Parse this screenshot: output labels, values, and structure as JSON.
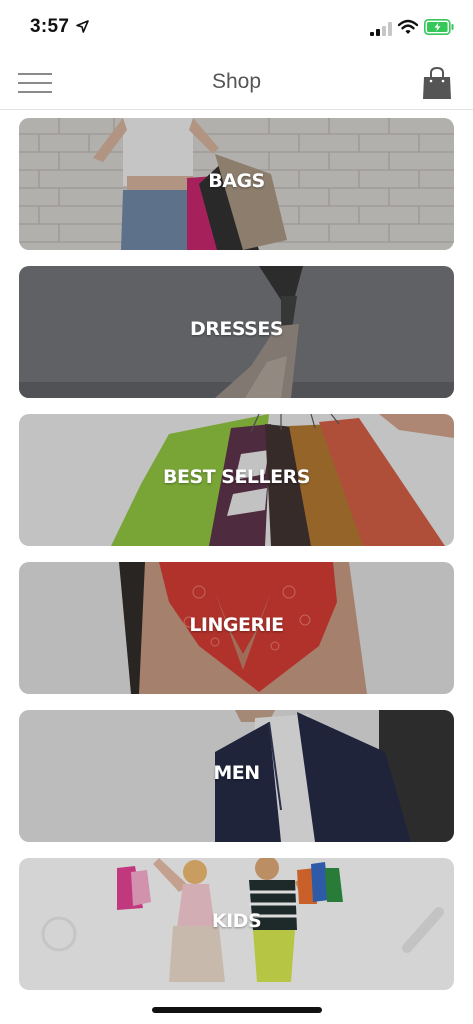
{
  "status_bar": {
    "time": "3:57"
  },
  "nav": {
    "title": "Shop"
  },
  "categories": [
    {
      "label": "BAGS"
    },
    {
      "label": "DRESSES"
    },
    {
      "label": "BEST SELLERS"
    },
    {
      "label": "LINGERIE"
    },
    {
      "label": "MEN"
    },
    {
      "label": "KIDS"
    }
  ],
  "colors": {
    "battery_fill": "#36c759",
    "nav_title": "#555555",
    "label_text": "#ffffff"
  },
  "icons": [
    "location-arrow-icon",
    "cellular-signal-icon",
    "wifi-icon",
    "battery-icon",
    "hamburger-menu-icon",
    "shopping-bag-icon"
  ]
}
